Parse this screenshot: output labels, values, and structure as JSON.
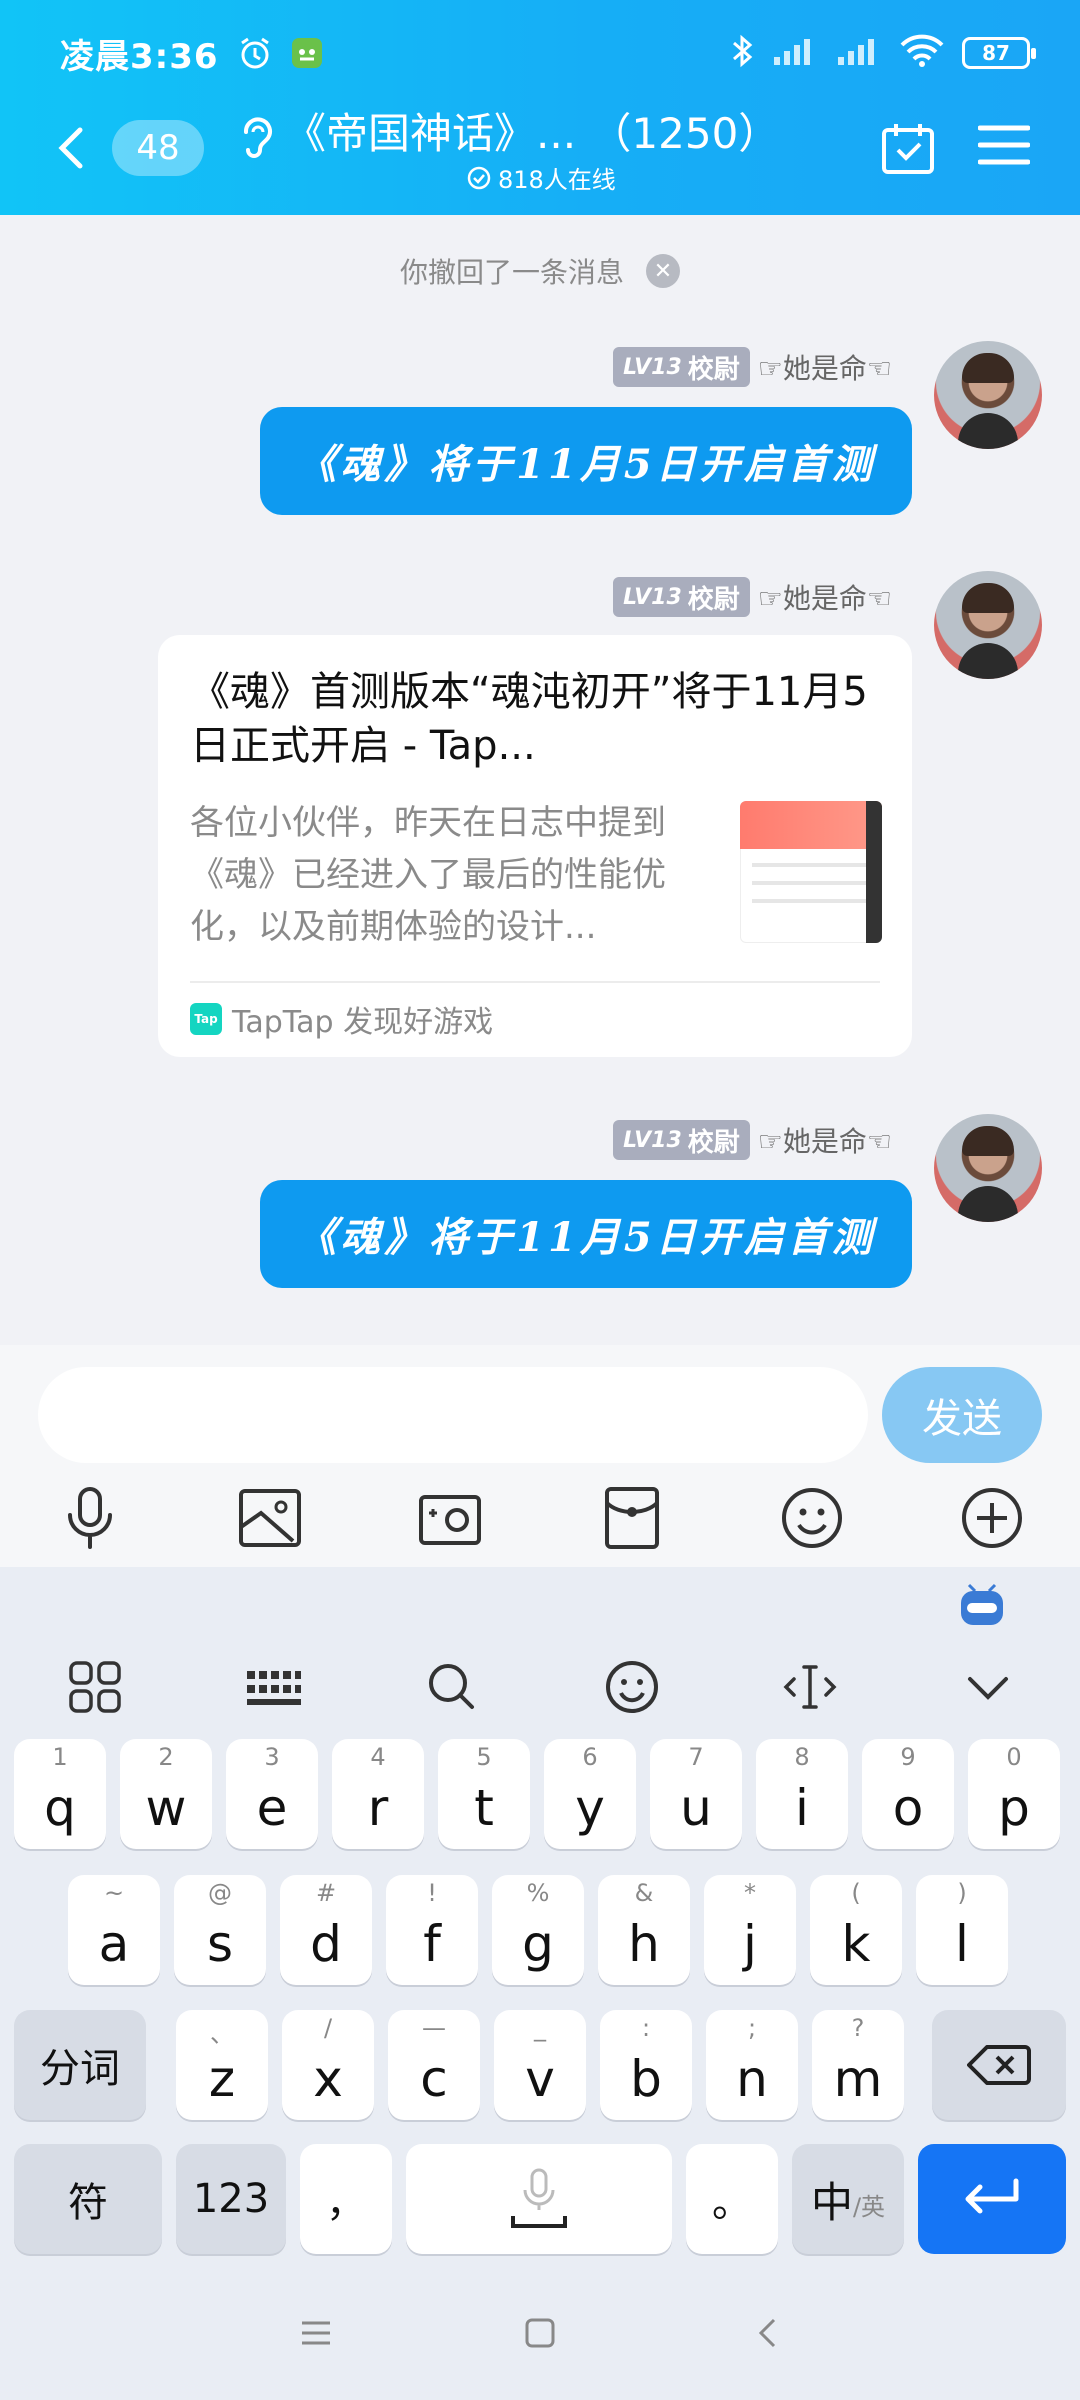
{
  "status": {
    "time": "凌晨3:36",
    "battery": "87"
  },
  "header": {
    "unread_count": "48",
    "title": "《帝国神话》... （1250）",
    "online": "818人在线"
  },
  "chat": {
    "recall_notice": "你撤回了一条消息",
    "sender": {
      "level": "LV13",
      "rank": "校尉",
      "nickname": "☞她是命☜"
    },
    "messages": [
      {
        "text": "《魂》将于11月5日开启首测"
      },
      {
        "card_title": "《魂》首测版本“魂沌初开”将于11月5日正式开启 - Tap...",
        "card_desc": "各位小伙伴，昨天在日志中提到《魂》已经进入了最后的性能优化，以及前期体验的设计...",
        "source_icon": "Tap",
        "source": "TapTap 发现好游戏"
      },
      {
        "text": "《魂》将于11月5日开启首测"
      }
    ]
  },
  "input": {
    "value": "",
    "send_label": "发送"
  },
  "keyboard": {
    "row1": [
      {
        "k": "q",
        "n": "1"
      },
      {
        "k": "w",
        "n": "2"
      },
      {
        "k": "e",
        "n": "3"
      },
      {
        "k": "r",
        "n": "4"
      },
      {
        "k": "t",
        "n": "5"
      },
      {
        "k": "y",
        "n": "6"
      },
      {
        "k": "u",
        "n": "7"
      },
      {
        "k": "i",
        "n": "8"
      },
      {
        "k": "o",
        "n": "9"
      },
      {
        "k": "p",
        "n": "0"
      }
    ],
    "row2": [
      {
        "k": "a",
        "n": "~"
      },
      {
        "k": "s",
        "n": "@"
      },
      {
        "k": "d",
        "n": "#"
      },
      {
        "k": "f",
        "n": "!"
      },
      {
        "k": "g",
        "n": "%"
      },
      {
        "k": "h",
        "n": "&"
      },
      {
        "k": "j",
        "n": "*"
      },
      {
        "k": "k",
        "n": "("
      },
      {
        "k": "l",
        "n": ")"
      }
    ],
    "row3": [
      {
        "k": "z",
        "n": "、"
      },
      {
        "k": "x",
        "n": "/"
      },
      {
        "k": "c",
        "n": "—"
      },
      {
        "k": "v",
        "n": "_"
      },
      {
        "k": "b",
        "n": ":"
      },
      {
        "k": "n",
        "n": ";"
      },
      {
        "k": "m",
        "n": "?"
      }
    ],
    "segment_label": "分词",
    "symbol_label": "符",
    "num_label": "123",
    "comma": "，",
    "period": "。",
    "lang_main": "中",
    "lang_alt": "/英"
  },
  "colors": {
    "header": "#16aef6",
    "bubble": "#0e9af0",
    "send": "#87c8f3",
    "enter": "#1575f5"
  }
}
